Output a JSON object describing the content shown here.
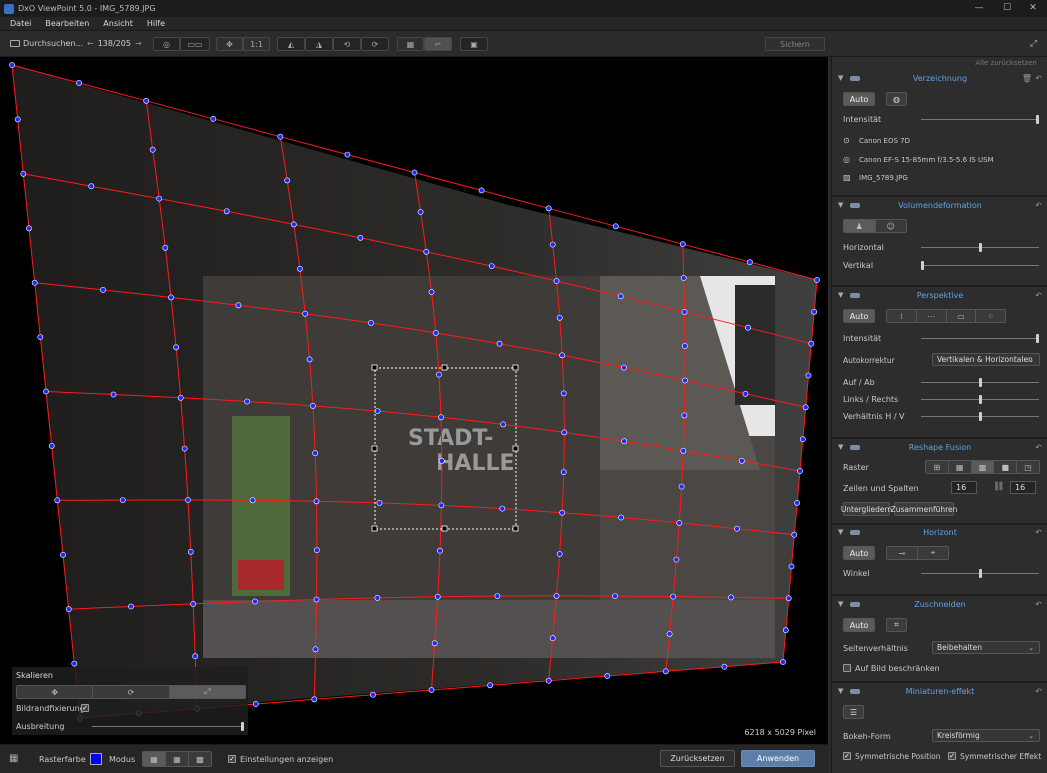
{
  "window": {
    "title": "DxO ViewPoint 5.0 - IMG_5789.JPG",
    "minimize": "—",
    "maximize": "☐",
    "close": "✕"
  },
  "menu": [
    "Datei",
    "Bearbeiten",
    "Ansicht",
    "Hilfe"
  ],
  "toolbar": {
    "browse_label": "Durchsuchen...",
    "counter": "138/205",
    "zoom_label": "1:1",
    "save_label": "Sichern"
  },
  "panel": {
    "reset_all": "Alle zurücksetzen",
    "verzeichnung": {
      "title": "Verzeichnung",
      "auto": "Auto",
      "intensity_label": "Intensität",
      "intensity": 1.0,
      "camera": "Canon EOS 7D",
      "lens": "Canon EF-S 15-85mm f/3.5-5.6 IS USM",
      "file": "IMG_5789.JPG"
    },
    "volumen": {
      "title": "Volumendeformation",
      "horizontal_label": "Horizontal",
      "horizontal": 0.5,
      "vertikal_label": "Vertikal",
      "vertikal": 0.0
    },
    "perspektive": {
      "title": "Perspektive",
      "auto": "Auto",
      "intensity_label": "Intensität",
      "intensity": 1.0,
      "autokorrektur_label": "Autokorrektur",
      "autokorrektur_value": "Vertikalen & Horizontalen",
      "auf_ab_label": "Auf / Ab",
      "auf_ab": 0.5,
      "links_rechts_label": "Links / Rechts",
      "links_rechts": 0.5,
      "verhaeltnis_label": "Verhältnis H / V",
      "verhaeltnis": 0.5
    },
    "reshape": {
      "title": "Reshape Fusion",
      "raster_label": "Raster",
      "zeilen_label": "Zeilen und Spalten",
      "rows": "16",
      "cols": "16",
      "unterteilen": "Untergliedern",
      "zusammen": "Zusammenführen"
    },
    "horizont": {
      "title": "Horizont",
      "auto": "Auto",
      "winkel_label": "Winkel",
      "winkel": 0.5
    },
    "zuschneiden": {
      "title": "Zuschneiden",
      "auto": "Auto",
      "seiten_label": "Seitenverhältnis",
      "seiten_value": "Beibehalten",
      "beschraenken_label": "Auf Bild beschränken"
    },
    "miniatur": {
      "title": "Miniaturen-effekt",
      "bokeh_label": "Bokeh-Form",
      "bokeh_value": "Kreisförmig",
      "sym_pos": "Symmetrische Position",
      "sym_eff": "Symmetrischer Effekt"
    }
  },
  "canvas": {
    "pixel_info": "6218 x 5029 Pixel",
    "skalieren_title": "Skalieren",
    "bildrand_label": "Bildrandfixierung",
    "ausbreitung_label": "Ausbreitung",
    "ausbreitung": 1.0
  },
  "bottom": {
    "rasterfarbe_label": "Rasterfarbe",
    "rasterfarbe_color": "#0000ff",
    "modus_label": "Modus",
    "einstellungen_label": "Einstellungen anzeigen",
    "reset_button": "Zurücksetzen",
    "apply_button": "Anwenden"
  },
  "colors": {
    "accent": "#5fa4e6",
    "grid_line": "#ff1a1a",
    "grid_point": "#1a2cff"
  }
}
